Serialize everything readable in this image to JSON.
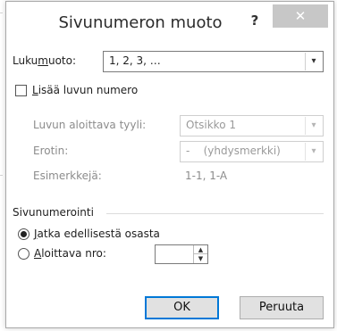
{
  "dialog": {
    "title": "Sivunumeron muoto",
    "help_label": "?",
    "close_label": "✕"
  },
  "format": {
    "label_pre": "Luku",
    "label_mnemonic": "m",
    "label_post": "uoto:",
    "value": "1, 2, 3, …",
    "arrow": "▾"
  },
  "include_chapter": {
    "label_mnemonic": "L",
    "label_rest": "isää luvun numero",
    "checked": false
  },
  "chapter_style": {
    "label": "Luvun aloittava tyyli:",
    "value": "Otsikko 1",
    "arrow": "▾"
  },
  "separator": {
    "label": "Erotin:",
    "value": "-    (yhdysmerkki)",
    "arrow": "▾"
  },
  "examples": {
    "label": "Esimerkkejä:",
    "value": "1-1, 1-A"
  },
  "numbering": {
    "group_label": "Sivunumerointi",
    "continue_mnemonic": "J",
    "continue_rest": "atka edellisestä osasta",
    "start_mnemonic": "A",
    "start_rest": "loittava nro:",
    "selected": "continue",
    "start_value": "",
    "spin_up": "▲",
    "spin_down": "▼"
  },
  "buttons": {
    "ok": "OK",
    "cancel": "Peruuta"
  }
}
